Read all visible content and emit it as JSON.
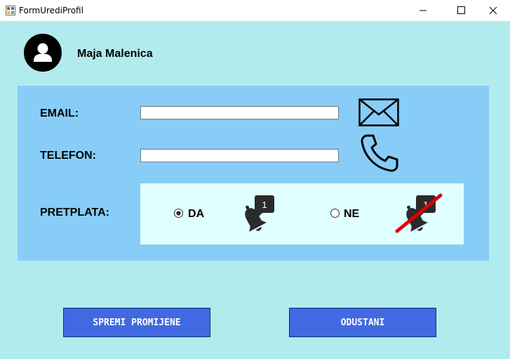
{
  "window": {
    "title": "FormUrediProfil",
    "minimize_icon": "minimize-icon",
    "maximize_icon": "maximize-icon",
    "close_icon": "close-icon"
  },
  "user": {
    "name": "Maja Malenica",
    "avatar_icon": "user-avatar-icon"
  },
  "form": {
    "email_label": "EMAIL:",
    "email_value": "",
    "email_icon": "envelope-icon",
    "phone_label": "TELEFON:",
    "phone_value": "",
    "phone_icon": "phone-icon",
    "subscription_label": "PRETPLATA:",
    "subscription_options": [
      {
        "label": "DA",
        "checked": true,
        "icon": "notification-bell-icon"
      },
      {
        "label": "NE",
        "checked": false,
        "icon": "notification-bell-off-icon"
      }
    ],
    "bell_badge": "1"
  },
  "buttons": {
    "save_label": "SPREMI PROMIJENE",
    "cancel_label": "ODUSTANI"
  },
  "colors": {
    "background": "#b2ebed",
    "panel": "#87cdf7",
    "subscription_box": "#e0ffff",
    "button": "#4169e1",
    "strike": "#e00000"
  }
}
